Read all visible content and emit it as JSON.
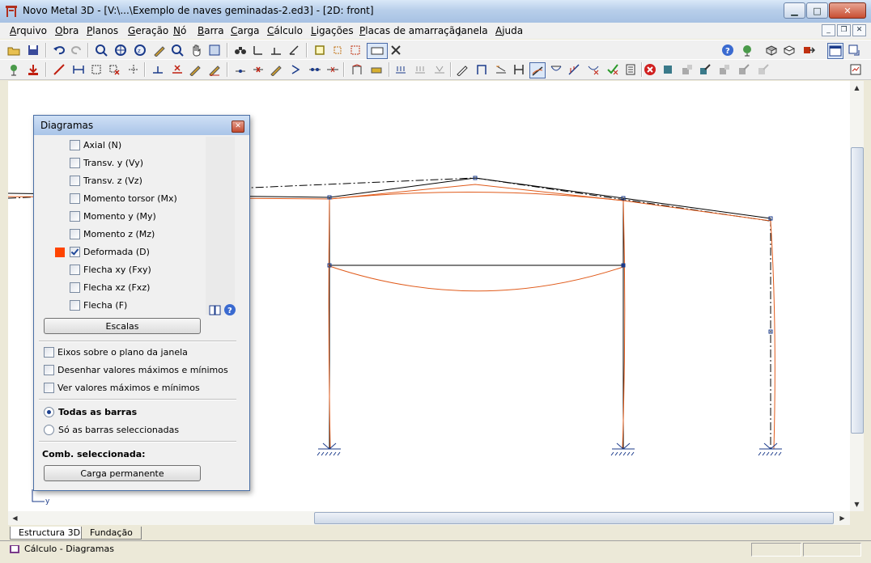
{
  "window": {
    "title": "Novo Metal 3D - [V:\\...\\Exemplo de naves geminadas-2.ed3] - [2D: front]"
  },
  "menu": [
    "Arquivo",
    "Obra",
    "Planos",
    "Geração",
    "Nó",
    "Barra",
    "Carga",
    "Cálculo",
    "Ligações",
    "Placas de amarração",
    "Janela",
    "Ajuda"
  ],
  "menu_mnemonic": [
    "A",
    "O",
    "P",
    "G",
    "N",
    "B",
    "C",
    "C",
    "L",
    "P",
    "J",
    "j"
  ],
  "toolbar1_icons": [
    "open-icon",
    "save-icon",
    "undo-icon",
    "redo-icon",
    "select-icon",
    "zoom-all-icon",
    "zoom-icon",
    "zoom-window-icon",
    "edit-icon",
    "pan-icon",
    "zoom-prev-icon",
    "binoculars-icon",
    "axes-icon",
    "plane-icon",
    "view-icon",
    "box-icon",
    "grid-icon",
    "snap-icon",
    "keyboard-icon",
    "tools-icon"
  ],
  "toolbar1_right_icons": [
    "help-icon",
    "globe-icon",
    "model-icon",
    "eye-icon",
    "export-icon",
    "window-icon",
    "window-switch-icon"
  ],
  "toolbar2_icons": [
    "node-icon",
    "download-icon",
    "bar-icon",
    "dim-icon",
    "box-select-icon",
    "delete-icon",
    "scale-icon",
    "plus-icon",
    "cross-icon",
    "pen-icon",
    "pen2-icon",
    "dot-icon",
    "cut-icon",
    "pencil-icon",
    "branch-icon",
    "link-icon",
    "arrows-icon",
    "calc-icon",
    "print-icon",
    "load-icon",
    "load2-icon",
    "load3-icon",
    "pen3-icon",
    "portal-icon",
    "wave-icon",
    "frame-icon",
    "deform-icon",
    "buckle-icon",
    "beam-icon",
    "beam-x-icon",
    "check-icon",
    "list-icon",
    "stop-icon",
    "square-icon",
    "design-icon",
    "design2-icon",
    "design3-icon",
    "design4-icon",
    "design5-icon"
  ],
  "dialog": {
    "title": "Diagramas",
    "items": [
      {
        "label": "Axial (N)",
        "checked": false
      },
      {
        "label": "Transv. y (Vy)",
        "checked": false
      },
      {
        "label": "Transv. z (Vz)",
        "checked": false
      },
      {
        "label": "Momento torsor (Mx)",
        "checked": false
      },
      {
        "label": "Momento y (My)",
        "checked": false
      },
      {
        "label": "Momento z (Mz)",
        "checked": false
      },
      {
        "label": "Deformada (D)",
        "checked": true,
        "color": "#ff4400"
      },
      {
        "label": "Flecha xy (Fxy)",
        "checked": false
      },
      {
        "label": "Flecha xz (Fxz)",
        "checked": false
      },
      {
        "label": "Flecha (F)",
        "checked": false
      }
    ],
    "scales_button": "Escalas",
    "options": [
      {
        "label": "Eixos sobre o plano da janela",
        "checked": false
      },
      {
        "label": "Desenhar valores máximos e mínimos",
        "checked": false
      },
      {
        "label": "Ver valores máximos e mínimos",
        "checked": false
      }
    ],
    "radio_all": "Todas as barras",
    "radio_selected": "Só as barras seleccionadas",
    "comb_label": "Comb. seleccionada:",
    "comb_button": "Carga permanente"
  },
  "tabs": [
    "Estructura 3D",
    "Fundação"
  ],
  "status": "Cálculo - Diagramas",
  "colors": {
    "deformed": "#e05a1a",
    "structure": "#000000",
    "accent": "#ff4400"
  }
}
